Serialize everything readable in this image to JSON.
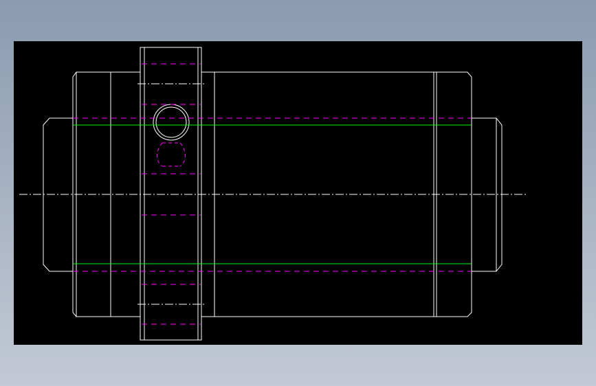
{
  "drawing": {
    "background_color": "#000000",
    "colors": {
      "outline": "#ffffff",
      "hidden_line": "#ff00ff",
      "bore_line": "#00ff00",
      "center_line": "#ffffff"
    },
    "linetypes": {
      "outline": "continuous",
      "hidden_line": "dashed",
      "center_line": "dash-dot"
    }
  }
}
